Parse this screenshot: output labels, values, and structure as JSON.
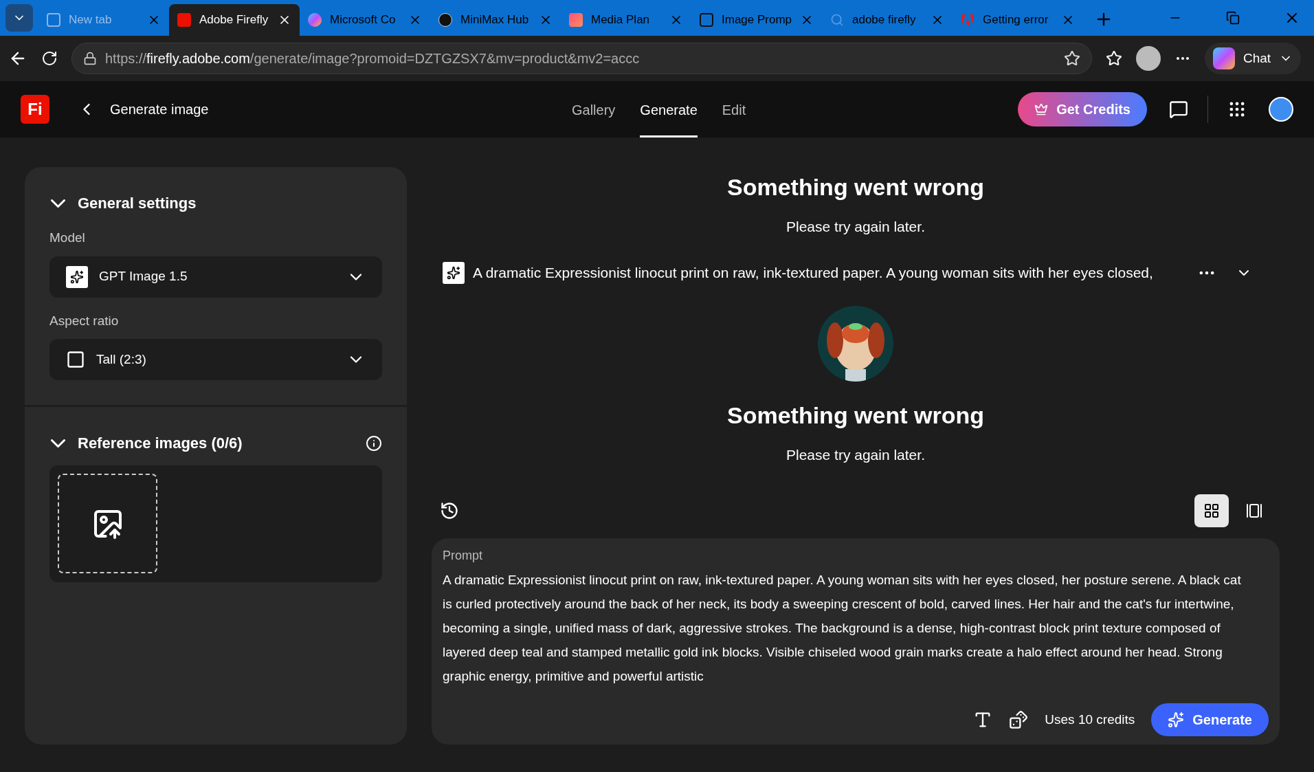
{
  "browser": {
    "tabs": [
      {
        "label": "New tab",
        "selected": false
      },
      {
        "label": "Adobe Firefly",
        "selected": true
      },
      {
        "label": "Microsoft Co",
        "selected": false
      },
      {
        "label": "MiniMax Hub",
        "selected": false
      },
      {
        "label": "Media Plan",
        "selected": false
      },
      {
        "label": "Image Promp",
        "selected": false
      },
      {
        "label": "adobe firefly",
        "selected": false
      },
      {
        "label": "Getting error",
        "selected": false
      }
    ],
    "address": {
      "host": "firefly.adobe.com",
      "path": "/generate/image?promoid=DZTGZSX7&mv=product&mv2=accc",
      "scheme": "https://"
    },
    "chat_button": "Chat"
  },
  "header": {
    "logo": "Fi",
    "title": "Generate image",
    "nav": [
      {
        "label": "Gallery",
        "selected": false
      },
      {
        "label": "Generate",
        "selected": true
      },
      {
        "label": "Edit",
        "selected": false
      }
    ],
    "credits_button": "Get Credits"
  },
  "settings": {
    "general": {
      "title": "General settings",
      "expanded": true,
      "model_label": "Model",
      "model": "GPT Image 1.5",
      "aspect_label": "Aspect ratio",
      "aspect": "Tall (2:3)"
    },
    "reference": {
      "title": "Reference images (0/6)",
      "expanded": true
    }
  },
  "results": [
    {
      "kind": "error",
      "title": "Something went wrong",
      "message": "Please try again later."
    },
    {
      "kind": "prompt",
      "text": "A dramatic Expressionist linocut print on raw, ink-textured paper. A young woman sits with her eyes closed,"
    },
    {
      "kind": "picture"
    },
    {
      "kind": "error",
      "title": "Something went wrong",
      "message": "Please try again later."
    }
  ],
  "view": [
    {
      "kind": "grid",
      "selected": true
    },
    {
      "kind": "single",
      "selected": false
    }
  ],
  "prompt": {
    "label": "Prompt",
    "text": "A dramatic Expressionist linocut print on raw, ink-textured paper. A young woman sits with her eyes closed, her posture serene. A black cat is curled protectively around the back of her neck, its body a sweeping crescent of bold, carved lines. Her hair and the cat's fur intertwine, becoming a single, unified mass of dark, aggressive strokes. The background is a dense, high-contrast block print texture composed of layered deep teal and stamped metallic gold ink blocks. Visible chiseled wood grain marks create a halo effect around her head. Strong graphic energy, primitive and powerful artistic",
    "credits": "Uses 10 credits",
    "generate_button": "Generate"
  }
}
